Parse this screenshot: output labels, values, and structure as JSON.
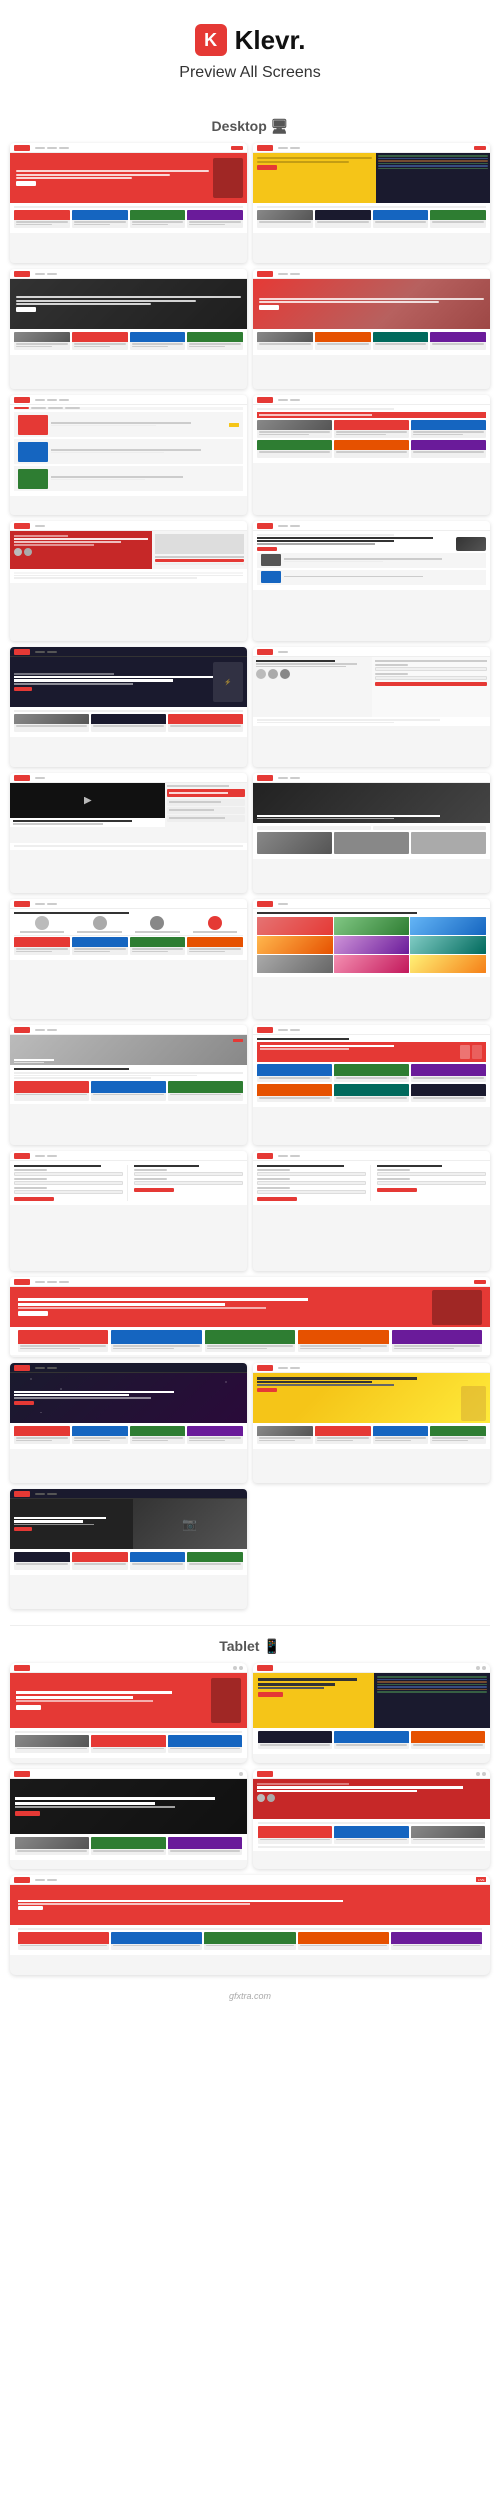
{
  "header": {
    "logo_letter": "K",
    "logo_name": "Klevr",
    "logo_dot": ".",
    "subtitle": "Preview All Screens"
  },
  "sections": {
    "desktop_label": "Desktop 🖥",
    "tablet_label": "Tablet 📱"
  },
  "desktop_screens": [
    {
      "id": 1,
      "type": "hero-red",
      "title": "Learn something new everyday.",
      "theme": "red"
    },
    {
      "id": 2,
      "type": "hero-yellow-code",
      "title": "Learn soo...",
      "theme": "yellow"
    },
    {
      "id": 3,
      "type": "hero-photo-dark",
      "title": "Learn something new everyday.",
      "theme": "dark"
    },
    {
      "id": 4,
      "type": "hero-photo-overlay",
      "title": "...thing new everyday.",
      "theme": "overlay"
    },
    {
      "id": 5,
      "type": "course-list",
      "title": "Browse Top Courses",
      "theme": "light"
    },
    {
      "id": 6,
      "type": "course-grid",
      "title": "Mobile & Desktop Friendly",
      "theme": "light"
    },
    {
      "id": 7,
      "type": "course-detail-red",
      "title": "VUE JAVASCRIPT COURSE",
      "theme": "red-sidebar"
    },
    {
      "id": 8,
      "type": "course-detail-make",
      "title": "Make Uber Clone App",
      "theme": "light"
    },
    {
      "id": 9,
      "type": "clone-app-dark",
      "title": "MAKE UBER CLONE APP",
      "theme": "dark"
    },
    {
      "id": 10,
      "type": "make-clone-form",
      "title": "Make Uber Clone App",
      "theme": "light"
    },
    {
      "id": 11,
      "type": "video-player",
      "title": "VUE JS MASTERCLASS",
      "theme": "dark"
    },
    {
      "id": 12,
      "type": "photo-editor",
      "title": "Filtering Interface",
      "theme": "light"
    },
    {
      "id": 13,
      "type": "vue-list",
      "title": "Vue Boot",
      "theme": "light"
    },
    {
      "id": 14,
      "type": "learn-interest",
      "title": "What do you interest?",
      "theme": "colorful"
    },
    {
      "id": 15,
      "type": "notebook",
      "title": "My Account",
      "theme": "light"
    },
    {
      "id": 16,
      "type": "categories",
      "title": "All Areas",
      "theme": "light"
    },
    {
      "id": 17,
      "type": "my-account-form",
      "title": "My Account",
      "theme": "light"
    },
    {
      "id": 18,
      "type": "my-account-form2",
      "title": "My Account",
      "theme": "light"
    },
    {
      "id": 19,
      "type": "hero-red-large",
      "title": "Learn something new everyday.",
      "theme": "red"
    },
    {
      "id": 20,
      "type": "hero-star-dark",
      "title": "Learn something new everyday.",
      "theme": "dark"
    },
    {
      "id": 21,
      "type": "hero-popcorn",
      "title": "Learn something new everyday.",
      "theme": "light"
    },
    {
      "id": 22,
      "type": "hero-camera",
      "title": "Learn so...",
      "theme": "dark"
    }
  ],
  "tablet_screens": [
    {
      "id": 23,
      "type": "tablet-red-hero",
      "title": "Learn something new everyday.",
      "theme": "red"
    },
    {
      "id": 24,
      "type": "tablet-yellow-code",
      "title": "Learn something new everyday.",
      "theme": "yellow"
    },
    {
      "id": 25,
      "type": "tablet-dark-photo",
      "title": "Learn something new everyday.",
      "theme": "dark"
    },
    {
      "id": 26,
      "type": "tablet-vue-course",
      "title": "VUE JAVASCRIPT COURSE",
      "theme": "red"
    },
    {
      "id": 27,
      "type": "tablet-live",
      "title": "Klevr.",
      "theme": "light-live"
    }
  ],
  "watermark": "gfxtra.com"
}
